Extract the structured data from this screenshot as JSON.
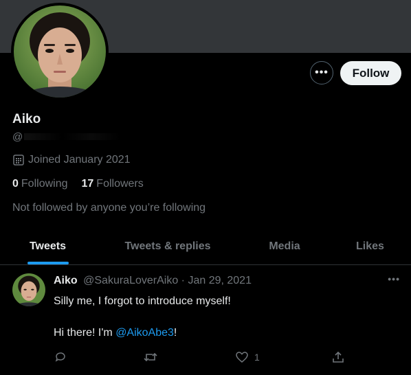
{
  "profile": {
    "name": "Aiko",
    "handle_prefix": "@",
    "joined": "Joined January 2021",
    "following_count": "0",
    "following_label": "Following",
    "followers_count": "17",
    "followers_label": "Followers",
    "not_followed": "Not followed by anyone you’re following"
  },
  "buttons": {
    "more": "•••",
    "follow": "Follow"
  },
  "tabs": [
    {
      "label": "Tweets",
      "active": true
    },
    {
      "label": "Tweets & replies",
      "active": false
    },
    {
      "label": "Media",
      "active": false
    },
    {
      "label": "Likes",
      "active": false
    }
  ],
  "tweet": {
    "name": "Aiko",
    "handle": "@SakuraLoverAiko",
    "separator": "·",
    "date": "Jan 29, 2021",
    "more": "•••",
    "line1": "Silly me, I forgot to introduce myself!",
    "line2_prefix": "Hi there! I'm ",
    "line2_mention": "@AikoAbe3",
    "line2_suffix": "!",
    "like_count": "1"
  },
  "colors": {
    "background": "#000000",
    "banner": "#333639",
    "accent": "#1d9bf0",
    "muted_text": "#71767b",
    "primary_text": "#e7e9ea"
  },
  "icons": {
    "joined": "calendar-icon",
    "reply": "reply-icon",
    "retweet": "retweet-icon",
    "like": "heart-icon",
    "share": "share-icon"
  }
}
